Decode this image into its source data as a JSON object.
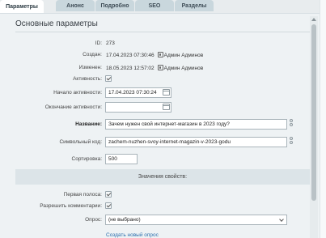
{
  "tabs": [
    {
      "label": "Параметры",
      "active": true
    },
    {
      "label": "Анонс",
      "active": false
    },
    {
      "label": "Подробно",
      "active": false
    },
    {
      "label": "SEO",
      "active": false
    },
    {
      "label": "Разделы",
      "active": false
    }
  ],
  "section_title": "Основные параметры",
  "fields": {
    "id": {
      "label": "ID:",
      "value": "273"
    },
    "created": {
      "label": "Создан:",
      "date": "17.04.2023 07:30:46",
      "user": "Админ Админов"
    },
    "modified": {
      "label": "Изменен:",
      "date": "18.05.2023 12:57:02",
      "user": "Админ Админов"
    },
    "active": {
      "label": "Активность:",
      "checked": true
    },
    "active_from": {
      "label": "Начало активности:",
      "value": "17.04.2023 07:30:24"
    },
    "active_to": {
      "label": "Окончание активности:",
      "value": ""
    },
    "name": {
      "label": "Название:",
      "value": "Зачем нужен свой интернет-магазин в 2023 году?"
    },
    "code": {
      "label": "Символьный код:",
      "value": "zachem-nuzhen-svoy-internet-magazin-v-2023-godu"
    },
    "sort": {
      "label": "Сортировка:",
      "value": "500"
    }
  },
  "properties_band": "Значения свойств:",
  "properties": {
    "first_strip": {
      "label": "Первая полоса:",
      "checked": true
    },
    "allow_comments": {
      "label": "Разрешить комментарии:",
      "checked": true
    },
    "poll": {
      "label": "Опрос:",
      "value": "(не выбрано)"
    },
    "create_poll_link": "Создать новый опрос"
  },
  "icons": {
    "user": "user-icon",
    "calendar": "calendar-icon",
    "edit": "edit-icon",
    "chevron": "chevron-down-icon"
  },
  "colors": {
    "background": "#eef2f4",
    "tab_inactive": "#c9d7dd",
    "band": "#dce4e8",
    "link": "#2c6fad"
  }
}
